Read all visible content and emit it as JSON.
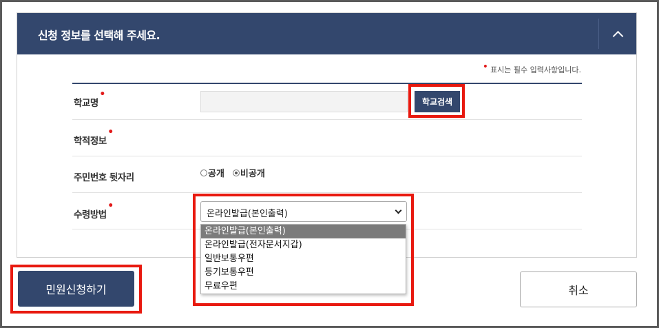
{
  "header": {
    "title": "신청 정보를 선택해 주세요.",
    "collapse_icon": "chevron-up-icon"
  },
  "required_note": "표시는 필수 입력사항입니다.",
  "form": {
    "school": {
      "label": "학교명",
      "input_value": "",
      "search_button": "학교검색"
    },
    "academic_info": {
      "label": "학적정보"
    },
    "resident_number": {
      "label": "주민번호 뒷자리",
      "options": [
        {
          "label": "공개",
          "selected": false
        },
        {
          "label": "비공개",
          "selected": true
        }
      ]
    },
    "receipt_method": {
      "label": "수령방법",
      "selected": "온라인발급(본인출력)",
      "options": [
        "온라인발급(본인출력)",
        "온라인발급(전자문서지갑)",
        "일반보통우편",
        "등기보통우편",
        "무료우편"
      ]
    }
  },
  "buttons": {
    "apply": "민원신청하기",
    "cancel": "취소"
  },
  "colors": {
    "primary": "#33476d",
    "required_mark": "#e21b1b",
    "highlight": "#e8190f",
    "selected_option": "#7b7b7b"
  }
}
